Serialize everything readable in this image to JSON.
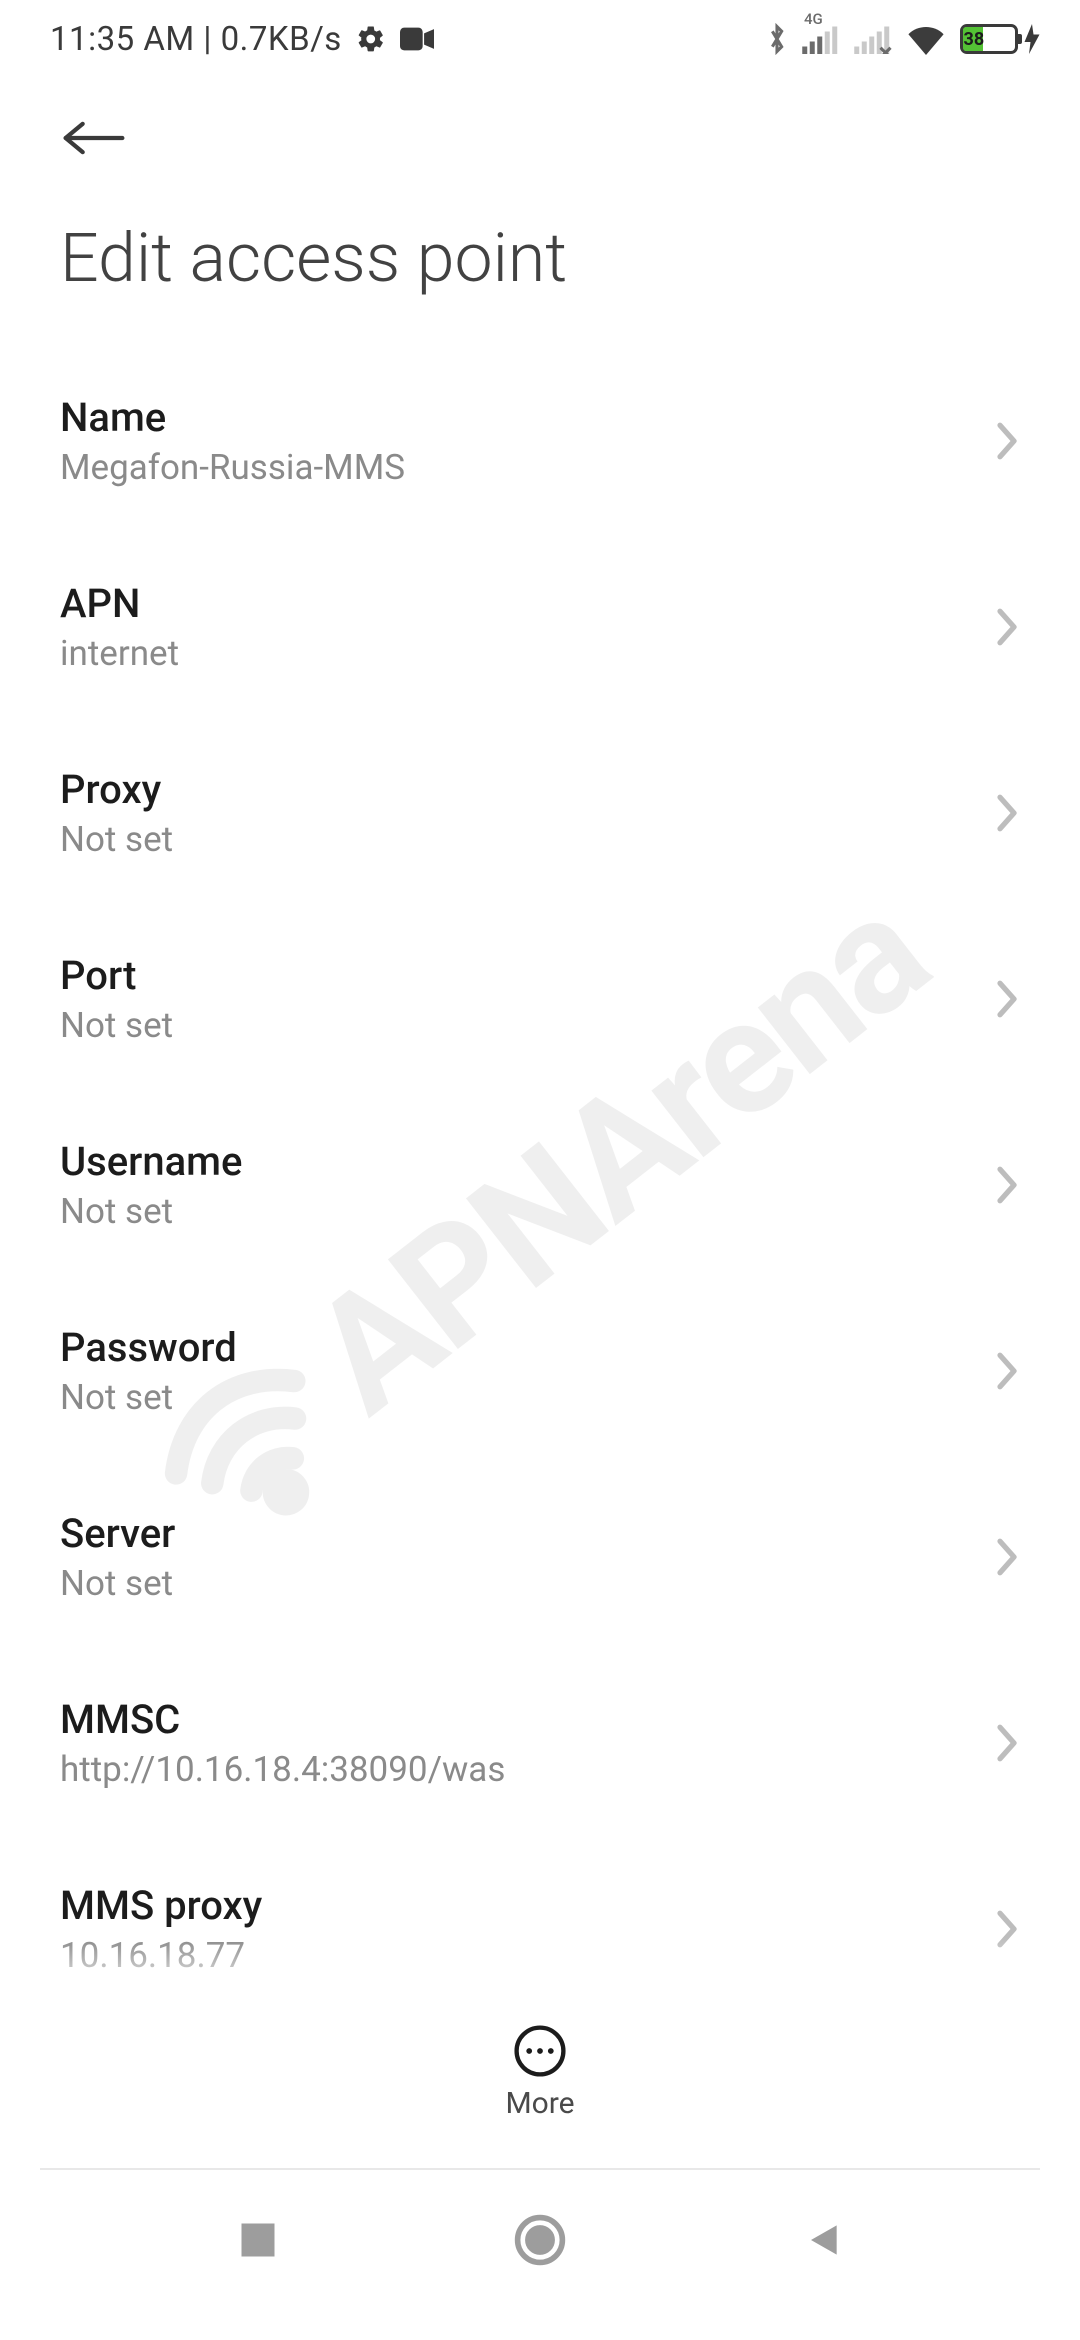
{
  "status_bar": {
    "time_net": "11:35 AM | 0.7KB/s",
    "network_label_4g": "4G",
    "battery_percent": "38"
  },
  "header": {
    "title": "Edit access point"
  },
  "settings": [
    {
      "label": "Name",
      "value": "Megafon-Russia-MMS"
    },
    {
      "label": "APN",
      "value": "internet"
    },
    {
      "label": "Proxy",
      "value": "Not set"
    },
    {
      "label": "Port",
      "value": "Not set"
    },
    {
      "label": "Username",
      "value": "Not set"
    },
    {
      "label": "Password",
      "value": "Not set"
    },
    {
      "label": "Server",
      "value": "Not set"
    },
    {
      "label": "MMSC",
      "value": "http://10.16.18.4:38090/was"
    },
    {
      "label": "MMS proxy",
      "value": "10.16.18.77"
    }
  ],
  "bottom": {
    "more_label": "More"
  },
  "watermark": {
    "text": "APNArena"
  }
}
